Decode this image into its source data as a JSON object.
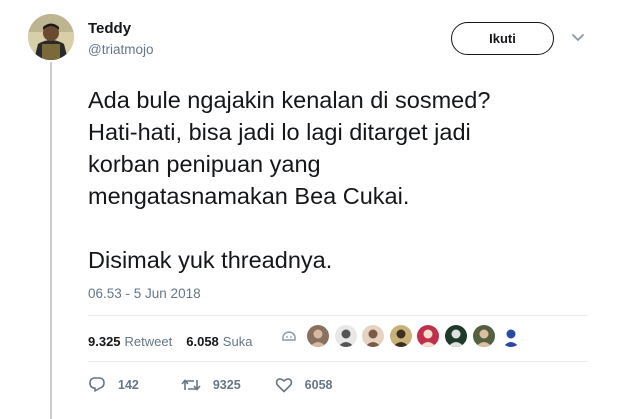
{
  "user": {
    "display_name": "Teddy",
    "username": "@triatmojo"
  },
  "follow_button": {
    "label": "Ikuti"
  },
  "tweet": {
    "text": "Ada bule ngajakin kenalan di sosmed?\nHati-hati, bisa jadi lo lagi ditarget jadi\nkorban penipuan yang\nmengatasnamakan Bea Cukai.\n\nDisimak yuk threadnya.",
    "timestamp": "06.53 - 5 Jun 2018"
  },
  "stats": {
    "retweets": "9.325",
    "retweets_label": "Retweet",
    "likes": "6.058",
    "likes_label": "Suka"
  },
  "liker_avatars": [
    {
      "bg": "#8a7060",
      "fg": "#d9b8a0"
    },
    {
      "bg": "#e8e8e8",
      "fg": "#555555"
    },
    {
      "bg": "#e6d2c0",
      "fg": "#7a5a48"
    },
    {
      "bg": "#c9b27a",
      "fg": "#3e3020"
    },
    {
      "bg": "#c0304a",
      "fg": "#f4e0d0"
    },
    {
      "bg": "#1e3a2a",
      "fg": "#e0e0e0"
    },
    {
      "bg": "#556040",
      "fg": "#d8c0a0"
    },
    {
      "bg": "#ffffff",
      "fg": "#2a4aa8"
    }
  ],
  "actions": {
    "reply_count": "142",
    "retweet_count": "9325",
    "like_count": "6058"
  },
  "colors": {
    "secondary_text": "#657786",
    "primary_text": "#14171a",
    "thread_line": "#c8ccd0"
  }
}
